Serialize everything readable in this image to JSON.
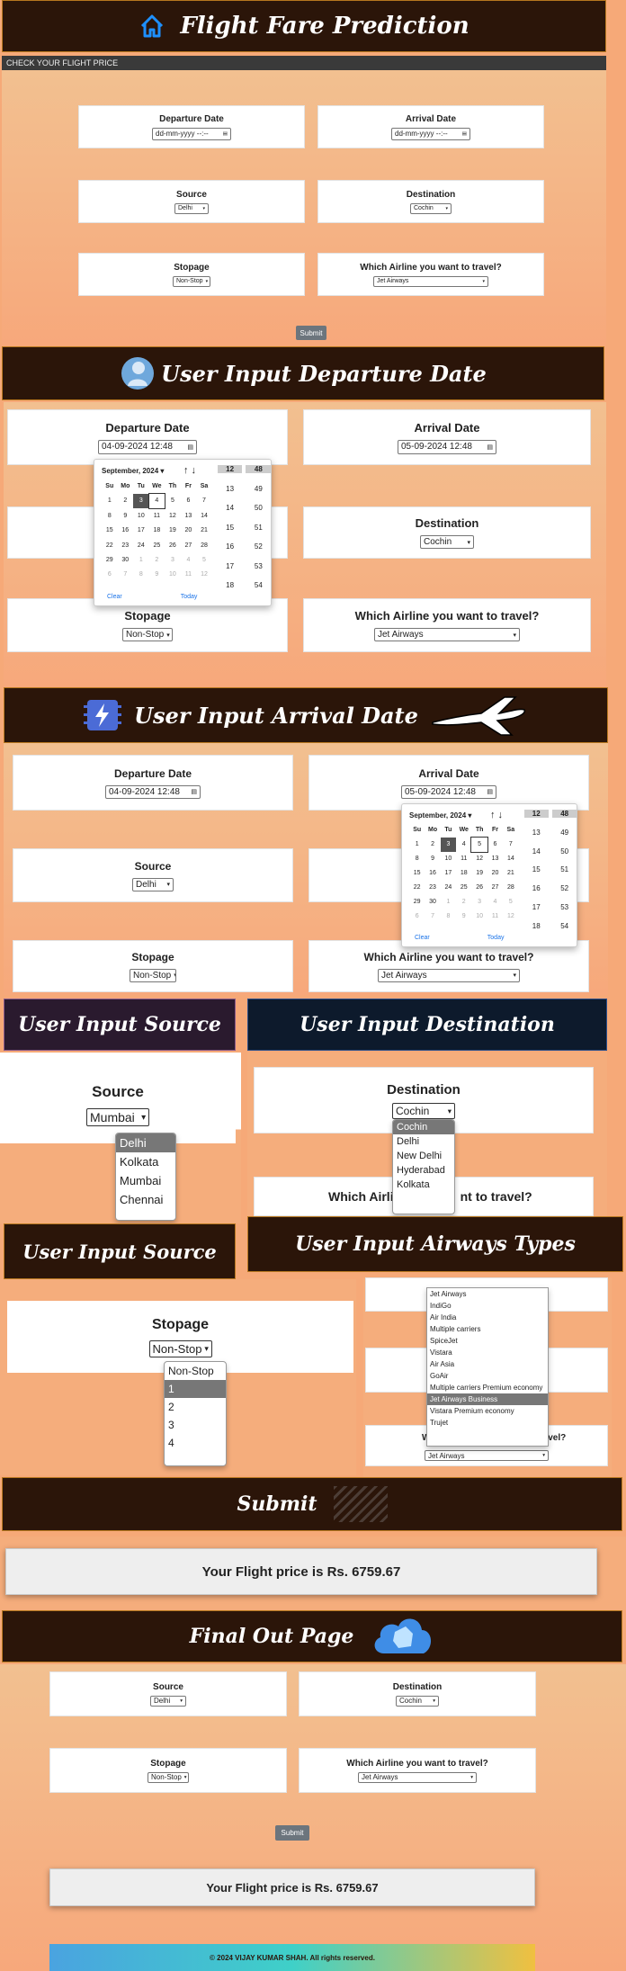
{
  "app": {
    "title": "Flight Fare Prediction",
    "subtitle": "CHECK YOUR FLIGHT PRICE"
  },
  "labels": {
    "departure": "Departure Date",
    "arrival": "Arrival Date",
    "source": "Source",
    "destination": "Destination",
    "stopage": "Stopage",
    "airline": "Which Airline you want to travel?",
    "submit": "Submit",
    "airline_partial_left": "Which Airli",
    "airline_partial_right": "nt to travel?",
    "airline_partial_w": "W",
    "airline_partial_rest": "travel?"
  },
  "values": {
    "date_placeholder": "dd-mm-yyyy --:--",
    "departure": "04-09-2024 12:48",
    "arrival": "05-09-2024 12:48",
    "source": "Delhi",
    "source_mumbai": "Mumbai",
    "destination": "Cochin",
    "stopage": "Non-Stop",
    "airline": "Jet Airways"
  },
  "sections": {
    "departure": "User Input Departure Date",
    "arrival": "User Input Arrival Date",
    "source": "User Input Source",
    "destination": "User Input Destination",
    "stopage": "User Input Source",
    "airways": "User Input Airways Types",
    "submit": "Submit",
    "final": "Final Out Page"
  },
  "calendar": {
    "month": "September, 2024",
    "weekdays": [
      "Su",
      "Mo",
      "Tu",
      "We",
      "Th",
      "Fr",
      "Sa"
    ],
    "weeks": [
      [
        "1",
        "2",
        "3",
        "4",
        "5",
        "6",
        "7"
      ],
      [
        "8",
        "9",
        "10",
        "11",
        "12",
        "13",
        "14"
      ],
      [
        "15",
        "16",
        "17",
        "18",
        "19",
        "20",
        "21"
      ],
      [
        "22",
        "23",
        "24",
        "25",
        "26",
        "27",
        "28"
      ],
      [
        "29",
        "30",
        "1",
        "2",
        "3",
        "4",
        "5"
      ],
      [
        "6",
        "7",
        "8",
        "9",
        "10",
        "11",
        "12"
      ]
    ],
    "hours": [
      "12",
      "13",
      "14",
      "15",
      "16",
      "17",
      "18"
    ],
    "minutes": [
      "48",
      "49",
      "50",
      "51",
      "52",
      "53",
      "54"
    ],
    "clear": "Clear",
    "today": "Today"
  },
  "source_options": [
    "Delhi",
    "Kolkata",
    "Mumbai",
    "Chennai"
  ],
  "destination_options": [
    "Cochin",
    "Delhi",
    "New Delhi",
    "Hyderabad",
    "Kolkata"
  ],
  "stopage_options": [
    "Non-Stop",
    "1",
    "2",
    "3",
    "4"
  ],
  "airline_options": [
    "Jet Airways",
    "IndiGo",
    "Air India",
    "Multiple carriers",
    "SpiceJet",
    "Vistara",
    "Air Asia",
    "GoAir",
    "Multiple carriers Premium economy",
    "Jet Airways Business",
    "Vistara Premium economy",
    "Trujet"
  ],
  "result": "Your Flight price is Rs. 6759.67",
  "footer": "© 2024 VIJAY KUMAR SHAH. All rights reserved.",
  "colors": {
    "banner_bg": "#2b1509",
    "banner_border": "#b7771f",
    "gradient_top": "#f2c090",
    "gradient_bottom": "#f7a87b",
    "button": "#6c757d",
    "home_icon": "#1e90ff"
  },
  "icons": [
    "home-icon",
    "person-icon",
    "bolt-icon",
    "airplane-icon",
    "cloud-icon"
  ]
}
